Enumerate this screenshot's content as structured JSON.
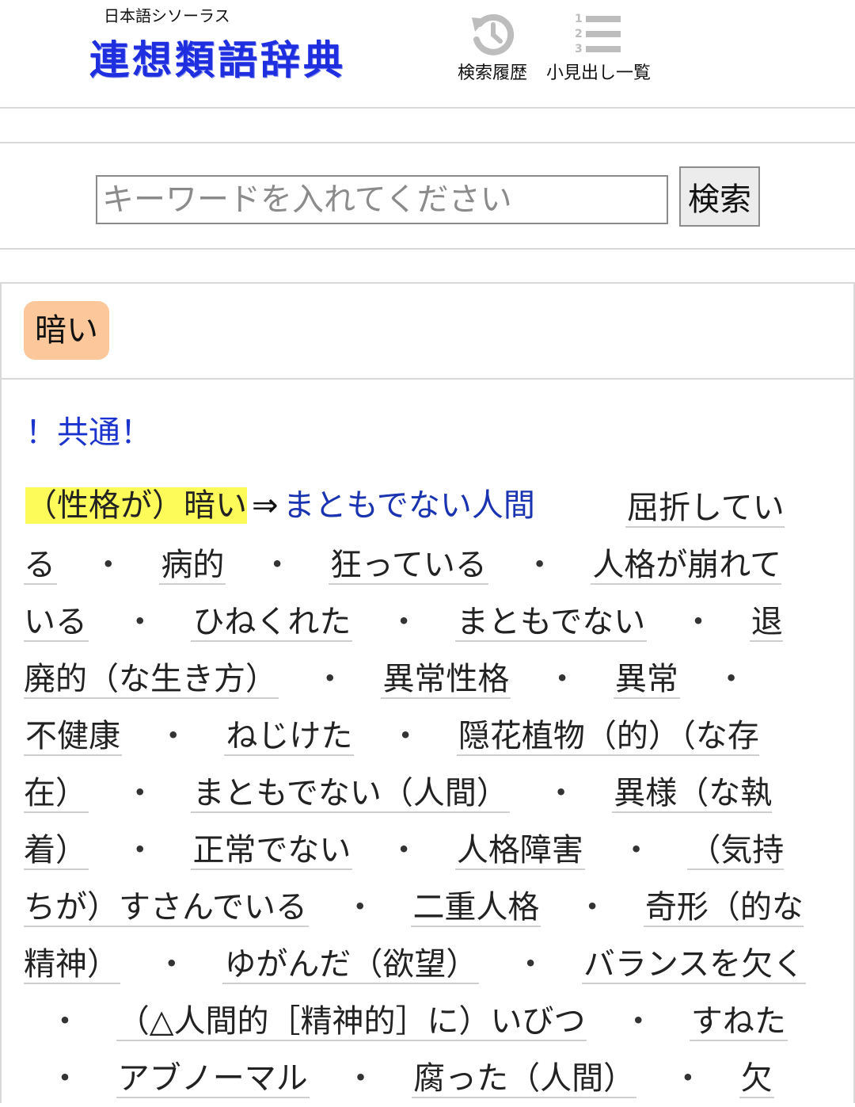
{
  "header": {
    "subtitle": "日本語シソーラス",
    "logo": "連想類語辞典",
    "history_label": "検索履歴",
    "list_label": "小見出し一覧"
  },
  "search": {
    "placeholder": "キーワードを入れてください",
    "button_label": "検索"
  },
  "result": {
    "word": "暗い",
    "common_label": "！共通！",
    "sense": "（性格が）暗い",
    "arrow": "⇒",
    "sense_link": "まともでない人間",
    "synonyms": [
      "屈折している",
      "病的",
      "狂っている",
      "人格が崩れている",
      "ひねくれた",
      "まともでない",
      "退廃的（な生き方）",
      "異常性格",
      "異常",
      "不健康",
      "ねじけた",
      "隠花植物（的）（な存在）",
      "まともでない（人間）",
      "異様（な執着）",
      "正常でない",
      "人格障害",
      "（気持ちが）すさんでいる",
      "二重人格",
      "奇形（的な精神）",
      "ゆがんだ（欲望）",
      "バランスを欠く",
      "（△人間的［精神的］に）いびつ",
      "すねた",
      "アブノーマル",
      "腐った（人間）",
      "欠"
    ],
    "separator": "・"
  },
  "colors": {
    "logo": "#1f2fe0",
    "link": "#1a33b0",
    "badge": "#fcc79a",
    "highlight": "#fdfb5a"
  }
}
